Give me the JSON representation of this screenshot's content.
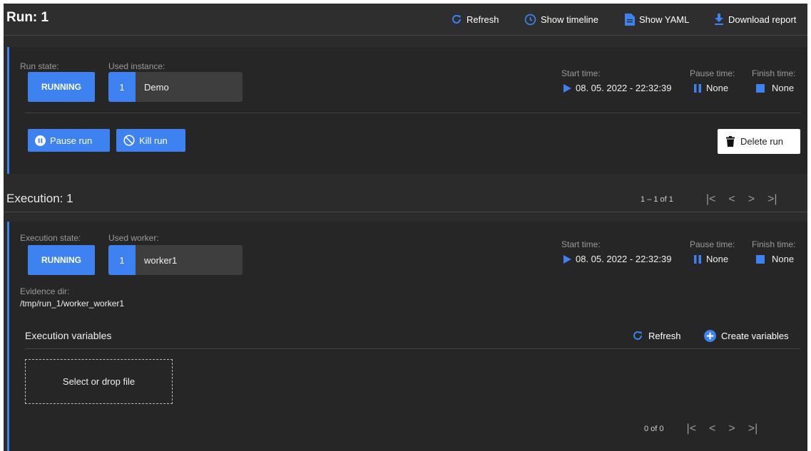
{
  "header": {
    "title": "Run: 1",
    "refresh": "Refresh",
    "timeline": "Show timeline",
    "yaml": "Show YAML",
    "download": "Download report"
  },
  "run": {
    "state_label": "Run state:",
    "state": "RUNNING",
    "instance_label": "Used instance:",
    "instance_num": "1",
    "instance_name": "Demo",
    "start_label": "Start time:",
    "start_time": "08. 05. 2022 - 22:32:39",
    "pause_label": "Pause time:",
    "pause_time": "None",
    "finish_label": "Finish time:",
    "finish_time": "None",
    "pause_btn": "Pause run",
    "kill_btn": "Kill run",
    "delete_btn": "Delete run"
  },
  "execution": {
    "title": "Execution: 1",
    "pager": "1 – 1 of 1",
    "state_label": "Execution state:",
    "state": "RUNNING",
    "worker_label": "Used worker:",
    "worker_num": "1",
    "worker_name": "worker1",
    "start_label": "Start time:",
    "start_time": "08. 05. 2022 - 22:32:39",
    "pause_label": "Pause time:",
    "pause_time": "None",
    "finish_label": "Finish time:",
    "finish_time": "None",
    "evidence_label": "Evidence dir:",
    "evidence_dir": "/tmp/run_1/worker_worker1",
    "variables_title": "Execution variables",
    "refresh": "Refresh",
    "create_vars": "Create variables",
    "drop_text": "Select or drop file",
    "vars_pager": "0 of 0"
  },
  "colors": {
    "accent": "#3d82f0",
    "background": "#2b2b2b"
  }
}
